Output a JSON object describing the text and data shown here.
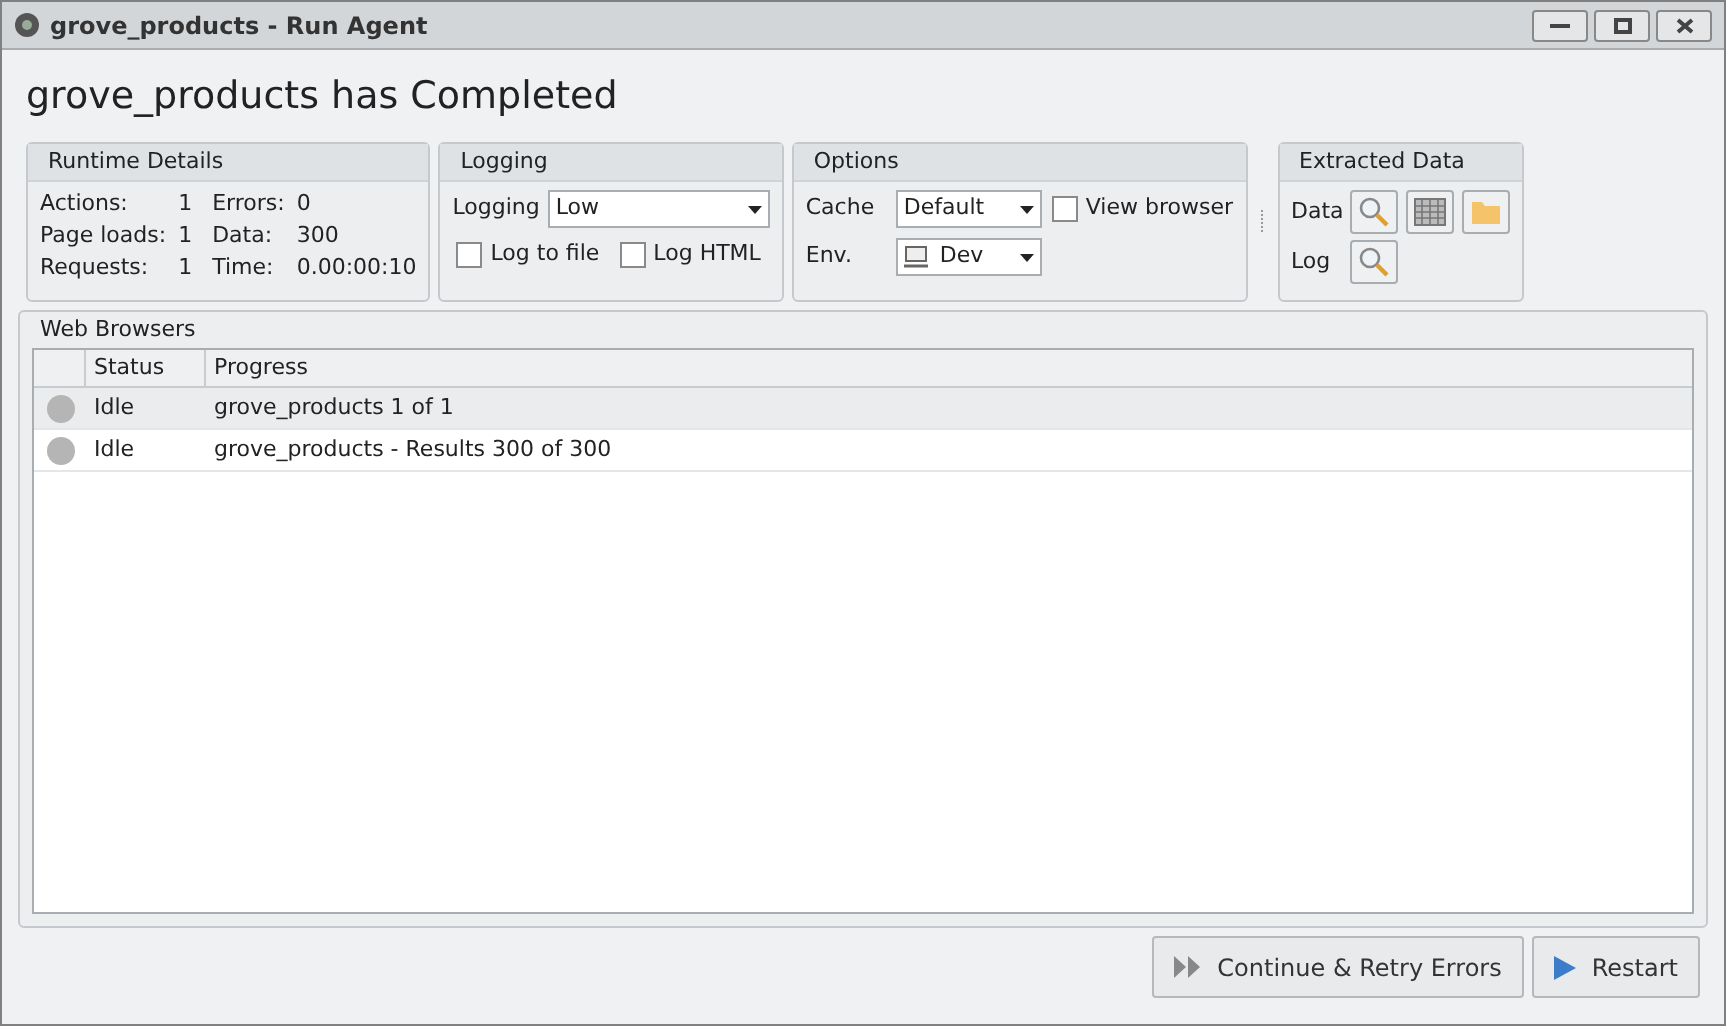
{
  "window": {
    "title": "grove_products - Run Agent"
  },
  "heading": "grove_products has Completed",
  "runtime_details": {
    "title": "Runtime Details",
    "rows": [
      [
        {
          "label": "Actions:",
          "value": "1"
        },
        {
          "label": "Errors:",
          "value": "0"
        }
      ],
      [
        {
          "label": "Page loads:",
          "value": "1"
        },
        {
          "label": "Data:",
          "value": "300"
        }
      ],
      [
        {
          "label": "Requests:",
          "value": "1"
        },
        {
          "label": "Time:",
          "value": "0.00:00:10"
        }
      ]
    ]
  },
  "logging": {
    "title": "Logging",
    "label": "Logging",
    "value": "Low",
    "checkboxes": [
      {
        "label": "Log to file",
        "checked": false
      },
      {
        "label": "Log HTML",
        "checked": false
      }
    ]
  },
  "options": {
    "title": "Options",
    "cache_label": "Cache",
    "cache_value": "Default",
    "view_browser": {
      "label": "View browser",
      "checked": false
    },
    "env_label": "Env.",
    "env_value": "Dev"
  },
  "extracted_data": {
    "title": "Extracted Data",
    "data_label": "Data",
    "log_label": "Log"
  },
  "web_browsers": {
    "title": "Web Browsers",
    "columns": [
      "Status",
      "Progress"
    ],
    "rows": [
      {
        "status": "Idle",
        "progress": "grove_products 1 of 1",
        "selected": true
      },
      {
        "status": "Idle",
        "progress": "grove_products - Results 300 of 300",
        "selected": false
      }
    ]
  },
  "buttons": [
    {
      "kind": "continue",
      "label": "Continue & Retry Errors"
    },
    {
      "kind": "restart",
      "label": "Restart"
    }
  ]
}
